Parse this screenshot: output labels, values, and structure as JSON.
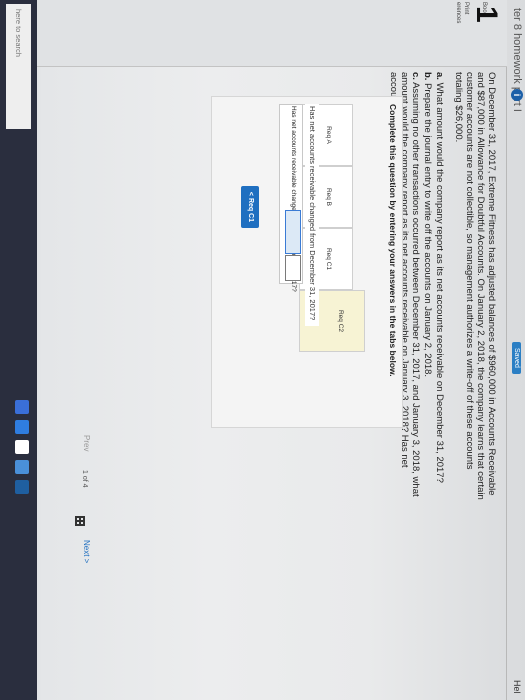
{
  "header": {
    "title": "ter 8 homework part I",
    "info_icon": "i",
    "saved": "Saved",
    "help": "Hel"
  },
  "sidebar": {
    "items": [
      {
        "label": "Book"
      },
      {
        "label": "Print"
      },
      {
        "label": "erences"
      }
    ]
  },
  "question": {
    "number": "1",
    "text": "On December 31, 2017, Extreme Fitness has adjusted balances of $960,000 in Accounts Receivable and $87,000 in Allowance for Doubtful Accounts. On January 2, 2018, the company learns that certain customer accounts are not collectible, so management authorizes a write-off of these accounts totaling $26,000.",
    "parts": [
      {
        "letter": "a.",
        "text": "What amount would the company report as its net accounts receivable on December 31, 2017?"
      },
      {
        "letter": "b.",
        "text": "Prepare the journal entry to write off the accounts on January 2, 2018."
      },
      {
        "letter": "c.",
        "text": "Assuming no other transactions occurred between December 31, 2017, and January 3, 2018, what amount would the company report as its net accounts receivable on January 3, 2018? Has net accounts receivable changed from December 31, 2017?"
      }
    ]
  },
  "panel": {
    "instruction": "Complete this question by entering your answers in the tabs below.",
    "tabs": [
      {
        "label": "Req A"
      },
      {
        "label": "Req B"
      },
      {
        "label": "Req C1"
      },
      {
        "label": "Req C2"
      }
    ],
    "active_tab": "Req C2",
    "sub_question": "Has net accounts receivable changed from December 31, 2017?",
    "answer_label": "Has net accounts receivable changed from December 31, 2017?",
    "nav_button": "< Req C1"
  },
  "pager": {
    "prev": "Prev",
    "page_text": "1 of 4",
    "next": "Next >"
  },
  "taskbar": {
    "search": "here to search"
  },
  "colors": {
    "accent": "#1f6fc0",
    "active_tab": "#f7f3d4",
    "taskbar": "#2a2e3e"
  }
}
